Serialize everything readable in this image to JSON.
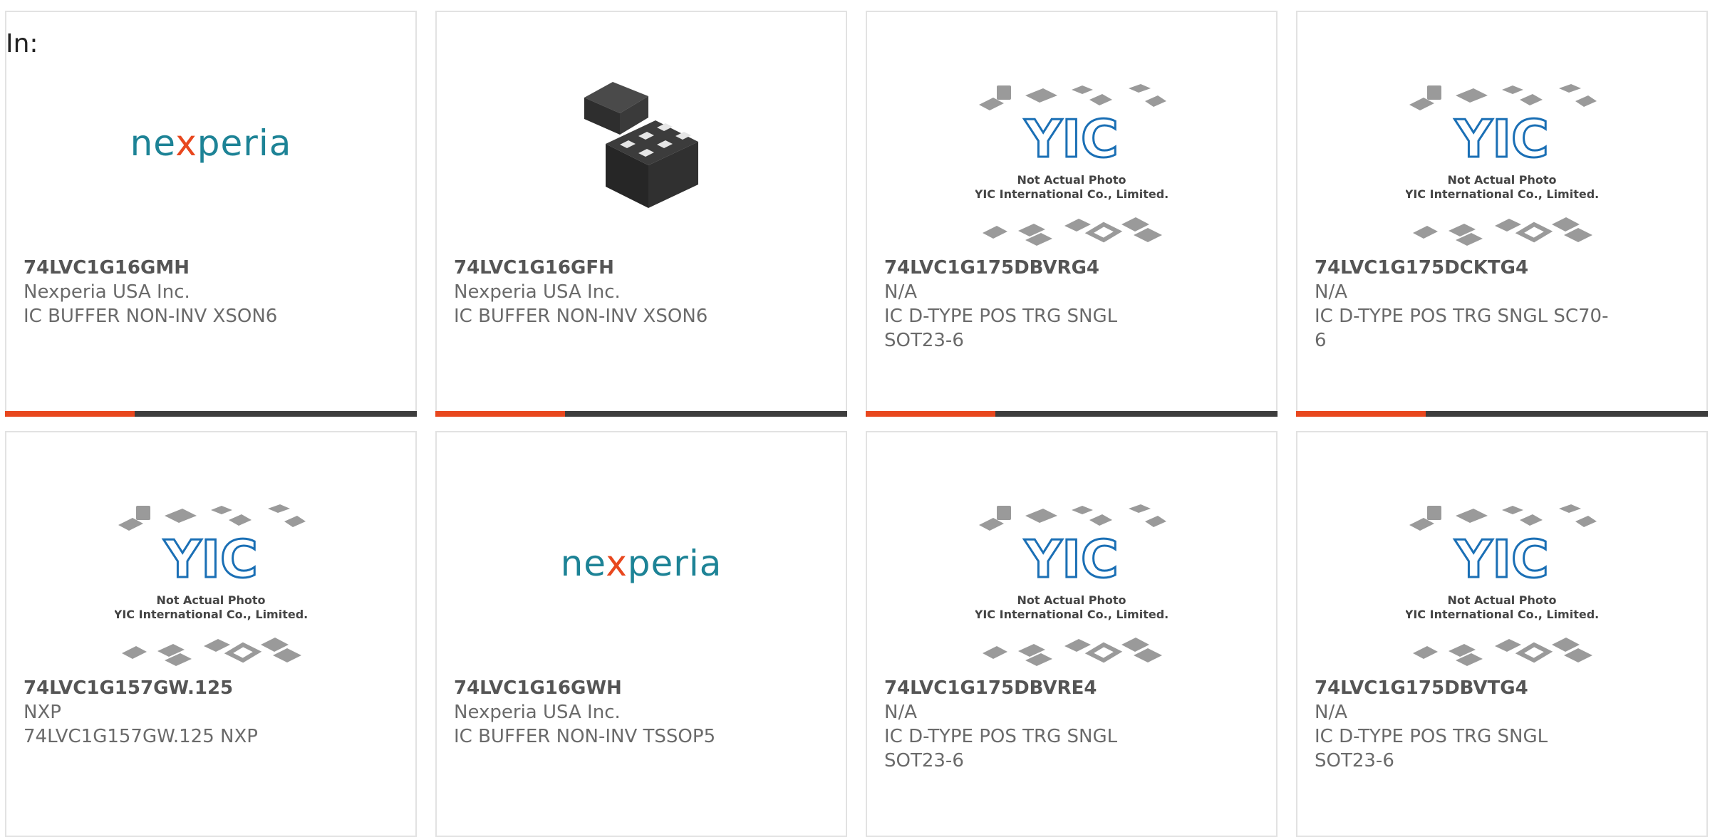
{
  "page": {
    "label": "In:"
  },
  "image_texts": {
    "placeholder_line1": "Not Actual Photo",
    "placeholder_line2": "YIC International Co., Limited.",
    "placeholder_mark": "YIC",
    "brand_logo_pre": "ne",
    "brand_logo_x": "x",
    "brand_logo_post": "peria"
  },
  "colors": {
    "accent": "#e8471e",
    "bar_dark": "#3d3d3d",
    "brand_teal": "#1d8396",
    "yic_blue": "#1a6fb5"
  },
  "products": [
    {
      "part_number": "74LVC1G16GMH",
      "manufacturer": "Nexperia USA Inc.",
      "desc_line1": "IC BUFFER NON-INV XSON6",
      "desc_line2": "",
      "image": "nexperia-logo"
    },
    {
      "part_number": "74LVC1G16GFH",
      "manufacturer": "Nexperia USA Inc.",
      "desc_line1": "IC BUFFER NON-INV XSON6",
      "desc_line2": "",
      "image": "chip-package-photo"
    },
    {
      "part_number": "74LVC1G175DBVRG4",
      "manufacturer": "N/A",
      "desc_line1": "IC D-TYPE POS TRG SNGL",
      "desc_line2": "SOT23-6",
      "image": "yic-placeholder"
    },
    {
      "part_number": "74LVC1G175DCKTG4",
      "manufacturer": "N/A",
      "desc_line1": "IC D-TYPE POS TRG SNGL SC70-",
      "desc_line2": "6",
      "image": "yic-placeholder"
    },
    {
      "part_number": "74LVC1G157GW.125",
      "manufacturer": "NXP",
      "desc_line1": "74LVC1G157GW.125 NXP",
      "desc_line2": "",
      "image": "yic-placeholder"
    },
    {
      "part_number": "74LVC1G16GWH",
      "manufacturer": "Nexperia USA Inc.",
      "desc_line1": "IC BUFFER NON-INV TSSOP5",
      "desc_line2": "",
      "image": "nexperia-logo"
    },
    {
      "part_number": "74LVC1G175DBVRE4",
      "manufacturer": "N/A",
      "desc_line1": "IC D-TYPE POS TRG SNGL",
      "desc_line2": "SOT23-6",
      "image": "yic-placeholder"
    },
    {
      "part_number": "74LVC1G175DBVTG4",
      "manufacturer": "N/A",
      "desc_line1": "IC D-TYPE POS TRG SNGL",
      "desc_line2": "SOT23-6",
      "image": "yic-placeholder"
    }
  ]
}
